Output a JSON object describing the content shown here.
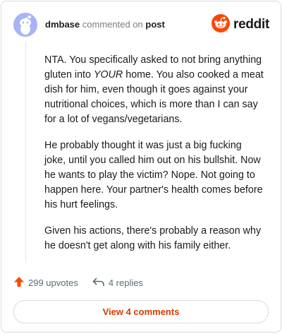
{
  "header": {
    "username": "dmbase",
    "action_text": "commented on",
    "post_link": "post",
    "brand_name": "reddit"
  },
  "comment": {
    "paragraphs": [
      "NTA. You specifically asked to not bring anything gluten into YOUR home. You also cooked a meat dish for him, even though it goes against your nutritional choices, which is more than I can say for a lot of vegans/vegetarians.",
      "He probably thought it was just a big fucking joke, until you called him out on his bullshit. Now he wants to play the victim? Nope. Not going to happen here. Your partner's health comes before his hurt feelings.",
      "Given his actions, there's probably a reason why he doesn't get along with his family either."
    ],
    "p1_before": "NTA. You specifically asked to not bring anything gluten into ",
    "p1_emphasis": "YOUR",
    "p1_after": " home. You also cooked a meat dish for him, even though it goes against your nutritional choices, which is more than I can say for a lot of vegans/vegetarians."
  },
  "footer": {
    "upvotes": "299 upvotes",
    "replies": "4 replies",
    "view_comments": "View 4 comments"
  },
  "colors": {
    "brand": "#ff4500",
    "upvote": "#ff4500",
    "link": "#d93a00",
    "avatar": "#a5b4f8"
  },
  "icons": [
    "snoo-avatar-icon",
    "reddit-logo-icon",
    "upvote-arrow-icon",
    "reply-arrow-icon"
  ]
}
